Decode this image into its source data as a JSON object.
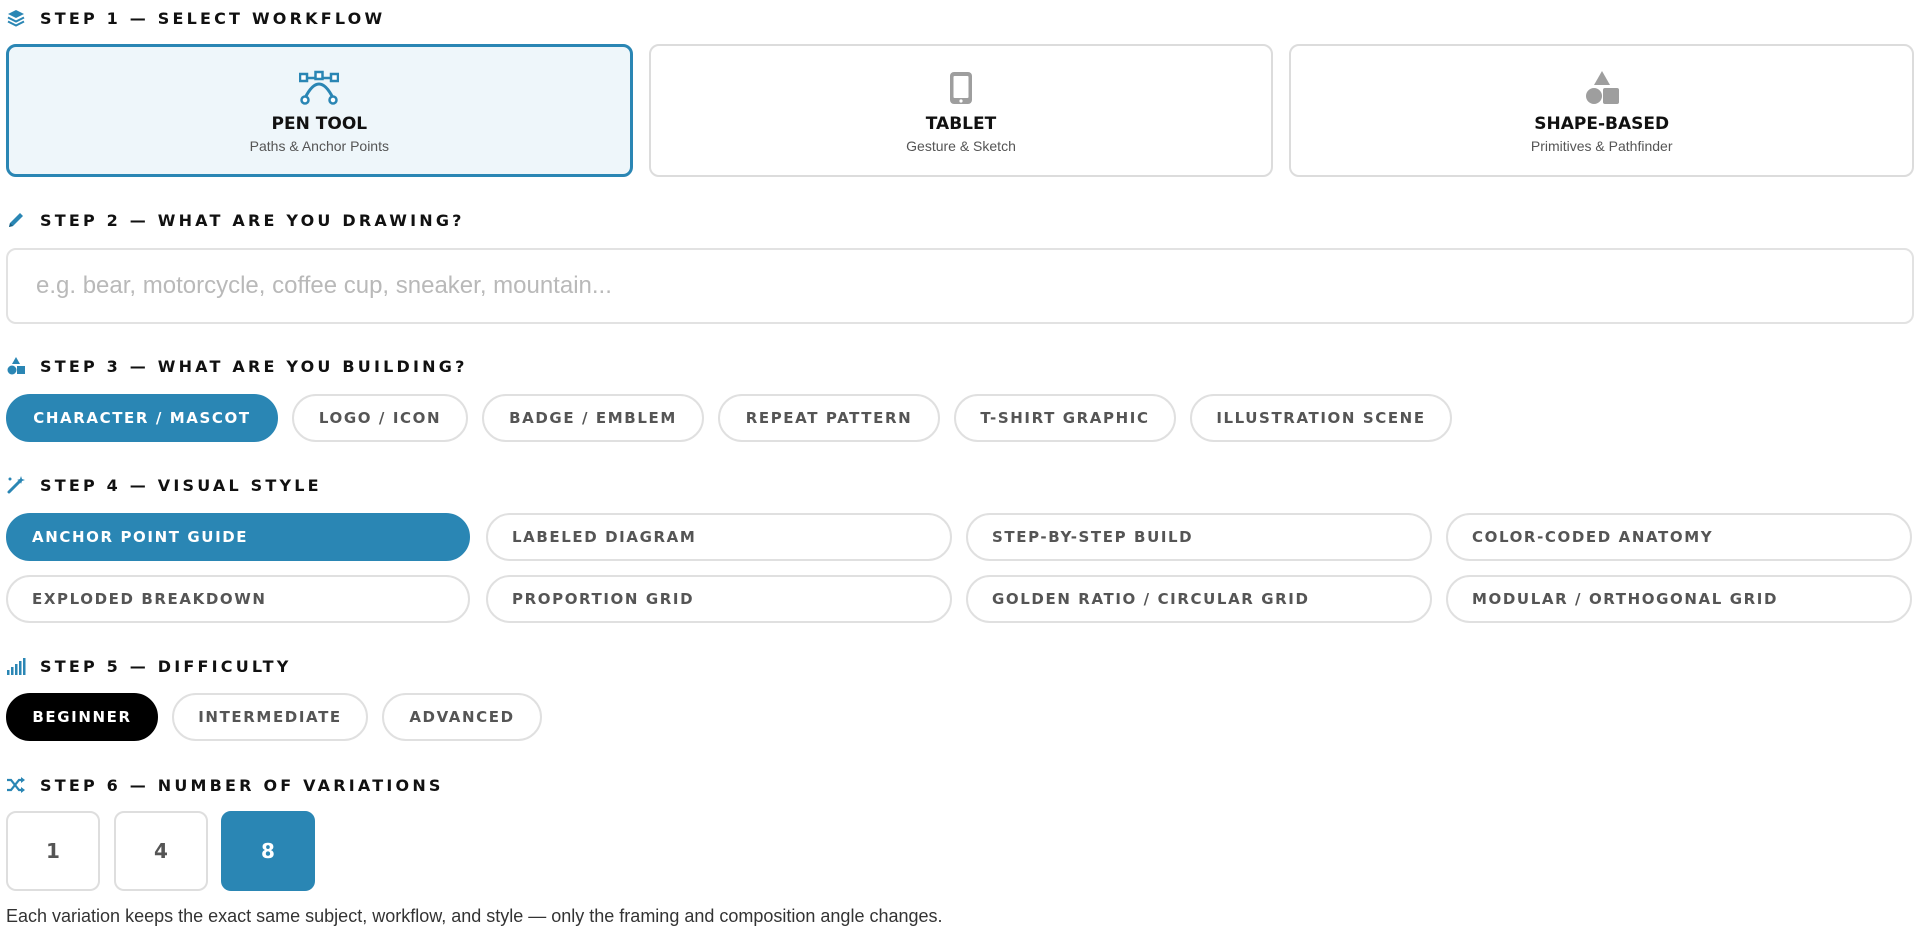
{
  "colors": {
    "accent": "#2a86b4",
    "selected_dark": "#000000",
    "border": "#e0e0e0",
    "muted_text": "#555555"
  },
  "step1": {
    "heading": "STEP 1 — SELECT WORKFLOW",
    "icon": "layers-icon",
    "cards": [
      {
        "title": "PEN TOOL",
        "subtitle": "Paths & Anchor Points",
        "icon": "pen-tool-bezier-icon",
        "selected": true
      },
      {
        "title": "TABLET",
        "subtitle": "Gesture & Sketch",
        "icon": "tablet-icon",
        "selected": false
      },
      {
        "title": "SHAPE-BASED",
        "subtitle": "Primitives & Pathfinder",
        "icon": "shapes-icon",
        "selected": false
      }
    ]
  },
  "step2": {
    "heading": "STEP 2 — WHAT ARE YOU DRAWING?",
    "icon": "pencil-icon",
    "input": {
      "value": "",
      "placeholder": "e.g. bear, motorcycle, coffee cup, sneaker, mountain..."
    }
  },
  "step3": {
    "heading": "STEP 3 — WHAT ARE YOU BUILDING?",
    "icon": "shapes-icon",
    "options": [
      "CHARACTER / MASCOT",
      "LOGO / ICON",
      "BADGE / EMBLEM",
      "REPEAT PATTERN",
      "T-SHIRT GRAPHIC",
      "ILLUSTRATION SCENE"
    ],
    "selected": "CHARACTER / MASCOT"
  },
  "step4": {
    "heading": "STEP 4 — VISUAL STYLE",
    "icon": "magic-wand-icon",
    "options": [
      "ANCHOR POINT GUIDE",
      "LABELED DIAGRAM",
      "STEP-BY-STEP BUILD",
      "COLOR-CODED ANATOMY",
      "EXPLODED BREAKDOWN",
      "PROPORTION GRID",
      "GOLDEN RATIO / CIRCULAR GRID",
      "MODULAR / ORTHOGONAL GRID"
    ],
    "selected": "ANCHOR POINT GUIDE"
  },
  "step5": {
    "heading": "STEP 5 — DIFFICULTY",
    "icon": "signal-bars-icon",
    "options": [
      "BEGINNER",
      "INTERMEDIATE",
      "ADVANCED"
    ],
    "selected": "BEGINNER"
  },
  "step6": {
    "heading": "STEP 6 — NUMBER OF VARIATIONS",
    "icon": "shuffle-icon",
    "options": [
      "1",
      "4",
      "8"
    ],
    "selected": "8",
    "note": "Each variation keeps the exact same subject, workflow, and style — only the framing and composition angle changes."
  }
}
